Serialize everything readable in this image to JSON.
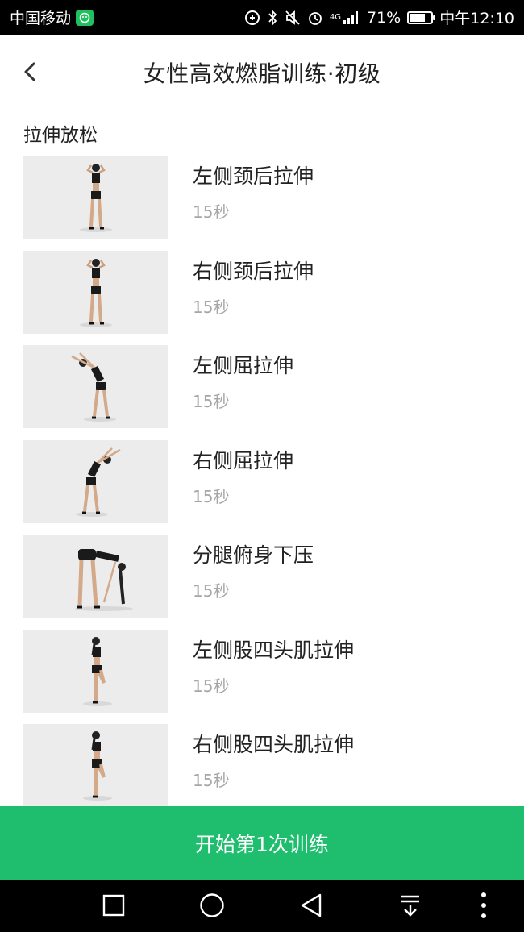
{
  "status_bar": {
    "carrier": "中国移动",
    "network": "4G",
    "battery_text": "71%",
    "battery_level": 0.71,
    "time": "中午12:10"
  },
  "header": {
    "title": "女性高效燃脂训练·初级",
    "back_icon": "chevron-left-icon"
  },
  "section": {
    "title": "拉伸放松"
  },
  "exercises": [
    {
      "name": "左侧颈后拉伸",
      "duration": "15秒",
      "pose": "neck-stretch"
    },
    {
      "name": "右侧颈后拉伸",
      "duration": "15秒",
      "pose": "neck-stretch"
    },
    {
      "name": "左侧屈拉伸",
      "duration": "15秒",
      "pose": "side-bend-left"
    },
    {
      "name": "右侧屈拉伸",
      "duration": "15秒",
      "pose": "side-bend-right"
    },
    {
      "name": "分腿俯身下压",
      "duration": "15秒",
      "pose": "forward-fold"
    },
    {
      "name": "左侧股四头肌拉伸",
      "duration": "15秒",
      "pose": "quad-stretch"
    },
    {
      "name": "右侧股四头肌拉伸",
      "duration": "15秒",
      "pose": "quad-stretch"
    }
  ],
  "start_button": {
    "label": "开始第1次训练"
  },
  "nav_bar": {
    "icons": [
      "square-icon",
      "circle-home-icon",
      "triangle-back-icon",
      "download-icon",
      "more-vertical-icon"
    ]
  },
  "colors": {
    "accent": "#1fbe6e",
    "thumb_bg": "#ececec",
    "secondary_text": "#a6a6a6"
  }
}
